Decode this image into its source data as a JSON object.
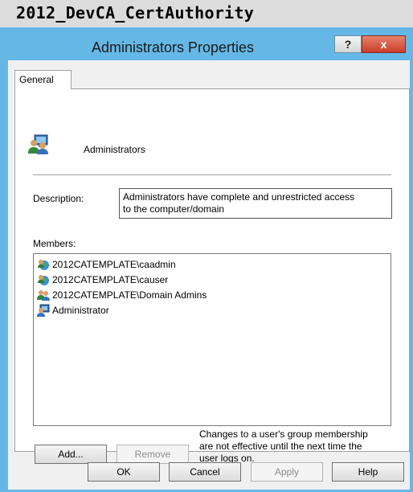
{
  "window": {
    "host_title": "2012_DevCA_CertAuthority"
  },
  "dialog": {
    "title": "Administrators Properties",
    "help_glyph": "?",
    "close_glyph": "x",
    "tabs": [
      {
        "label": "General",
        "selected": true
      }
    ]
  },
  "general": {
    "group_name": "Administrators",
    "group_icon": "group-icon",
    "description_label": "Description:",
    "description_line1": "Administrators have complete and unrestricted access",
    "description_line2": "to the computer/domain",
    "members_label": "Members:",
    "members": [
      {
        "name": "2012CATEMPLATE\\caadmin",
        "icon": "domain-user-icon"
      },
      {
        "name": "2012CATEMPLATE\\causer",
        "icon": "domain-user-icon"
      },
      {
        "name": "2012CATEMPLATE\\Domain Admins",
        "icon": "domain-group-icon"
      },
      {
        "name": "Administrator",
        "icon": "local-user-icon"
      }
    ],
    "add_label": "Add...",
    "remove_label": "Remove",
    "note_line1": "Changes to a user's group membership",
    "note_line2": "are not effective until the next time the",
    "note_line3": "user logs on."
  },
  "footer": {
    "ok_label": "OK",
    "cancel_label": "Cancel",
    "apply_label": "Apply",
    "help_label": "Help"
  },
  "colors": {
    "frame": "#65b8e6",
    "close_button": "#c8402a",
    "client_background": "#f0f0f0"
  }
}
